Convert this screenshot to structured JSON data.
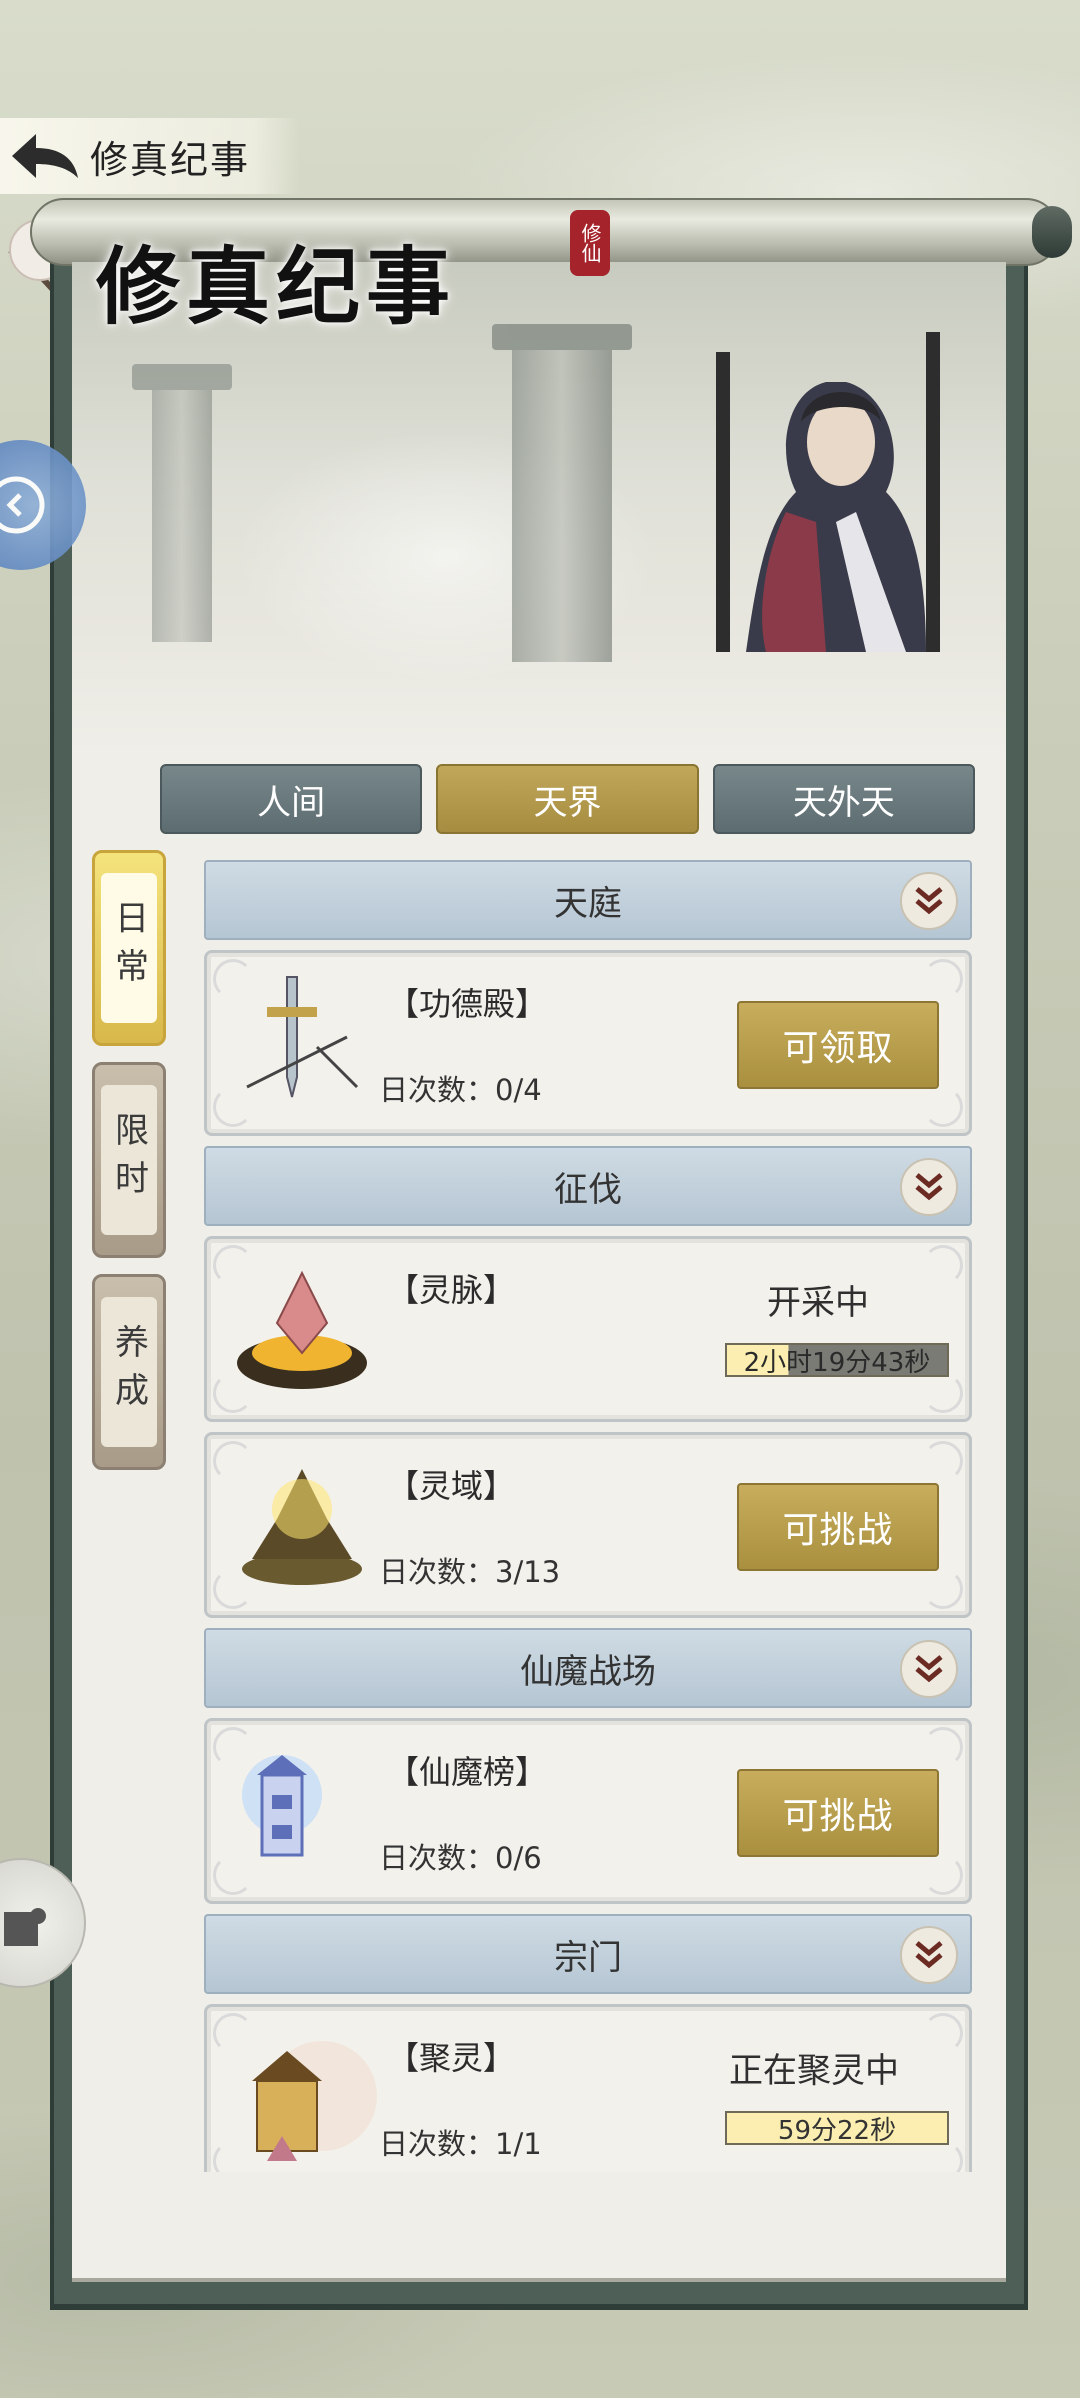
{
  "header": {
    "title": "修真纪事"
  },
  "banner": {
    "title": "修真纪事",
    "seal": "修仙"
  },
  "tabs": [
    {
      "label": "人间",
      "active": false
    },
    {
      "label": "天界",
      "active": true
    },
    {
      "label": "天外天",
      "active": false
    }
  ],
  "side_categories": [
    {
      "label": "日常",
      "active": true
    },
    {
      "label": "限时",
      "active": false
    },
    {
      "label": "养成",
      "active": false
    }
  ],
  "sections": [
    {
      "title": "天庭",
      "items": [
        {
          "name": "【功德殿】",
          "count": "日次数：0/4",
          "button": "可领取",
          "icon": "sword-weapon-icon"
        }
      ]
    },
    {
      "title": "征伐",
      "items": [
        {
          "name": "【灵脉】",
          "status": "开采中",
          "timer": "2小时19分43秒",
          "icon": "spirit-crystal-icon"
        },
        {
          "name": "【灵域】",
          "count": "日次数：3/13",
          "button": "可挑战",
          "icon": "spirit-domain-icon"
        }
      ]
    },
    {
      "title": "仙魔战场",
      "items": [
        {
          "name": "【仙魔榜】",
          "count": "日次数：0/6",
          "button": "可挑战",
          "icon": "celestial-tower-icon"
        }
      ]
    },
    {
      "title": "宗门",
      "items": [
        {
          "name": "【聚灵】",
          "count": "日次数：1/1",
          "status": "正在聚灵中",
          "timer": "59分22秒",
          "icon": "sect-palace-icon"
        }
      ]
    }
  ],
  "colors": {
    "accent_gold": "#b49a4a",
    "tab_gray": "#6a797d",
    "section_blue": "#c2d1dc",
    "panel_border": "#4d5f57"
  }
}
